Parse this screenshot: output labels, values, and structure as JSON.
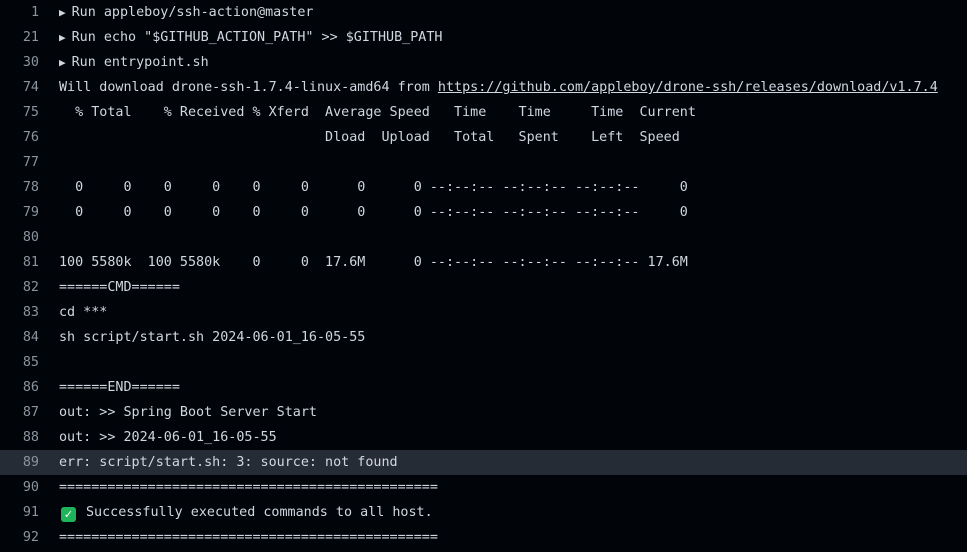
{
  "lines": [
    {
      "n": "1",
      "text": "Run appleboy/ssh-action@master",
      "group": true
    },
    {
      "n": "21",
      "text": "Run echo \"$GITHUB_ACTION_PATH\" >> $GITHUB_PATH",
      "group": true
    },
    {
      "n": "30",
      "text": "Run entrypoint.sh",
      "group": true
    },
    {
      "n": "74",
      "text": "Will download drone-ssh-1.7.4-linux-amd64 from ",
      "link": "https://github.com/appleboy/drone-ssh/releases/download/v1.7.4"
    },
    {
      "n": "75",
      "text": "  % Total    % Received % Xferd  Average Speed   Time    Time     Time  Current"
    },
    {
      "n": "76",
      "text": "                                 Dload  Upload   Total   Spent    Left  Speed"
    },
    {
      "n": "77",
      "text": ""
    },
    {
      "n": "78",
      "text": "  0     0    0     0    0     0      0      0 --:--:-- --:--:-- --:--:--     0"
    },
    {
      "n": "79",
      "text": "  0     0    0     0    0     0      0      0 --:--:-- --:--:-- --:--:--     0"
    },
    {
      "n": "80",
      "text": ""
    },
    {
      "n": "81",
      "text": "100 5580k  100 5580k    0     0  17.6M      0 --:--:-- --:--:-- --:--:-- 17.6M"
    },
    {
      "n": "82",
      "text": "======CMD======"
    },
    {
      "n": "83",
      "text": "cd ***"
    },
    {
      "n": "84",
      "text": "sh script/start.sh 2024-06-01_16-05-55"
    },
    {
      "n": "85",
      "text": ""
    },
    {
      "n": "86",
      "text": "======END======"
    },
    {
      "n": "87",
      "text": "out: >> Spring Boot Server Start"
    },
    {
      "n": "88",
      "text": "out: >> 2024-06-01_16-05-55"
    },
    {
      "n": "89",
      "text": "err: script/start.sh: 3: source: not found",
      "highlight": true
    },
    {
      "n": "90",
      "text": "==============================================="
    },
    {
      "n": "91",
      "text": "Successfully executed commands to all host.",
      "check": true
    },
    {
      "n": "92",
      "text": "==============================================="
    }
  ],
  "icons": {
    "group": "triangle-right-icon",
    "check": "check-box-icon"
  },
  "colors": {
    "background": "#010409",
    "highlight": "#262c36",
    "success": "#1fb45a"
  }
}
